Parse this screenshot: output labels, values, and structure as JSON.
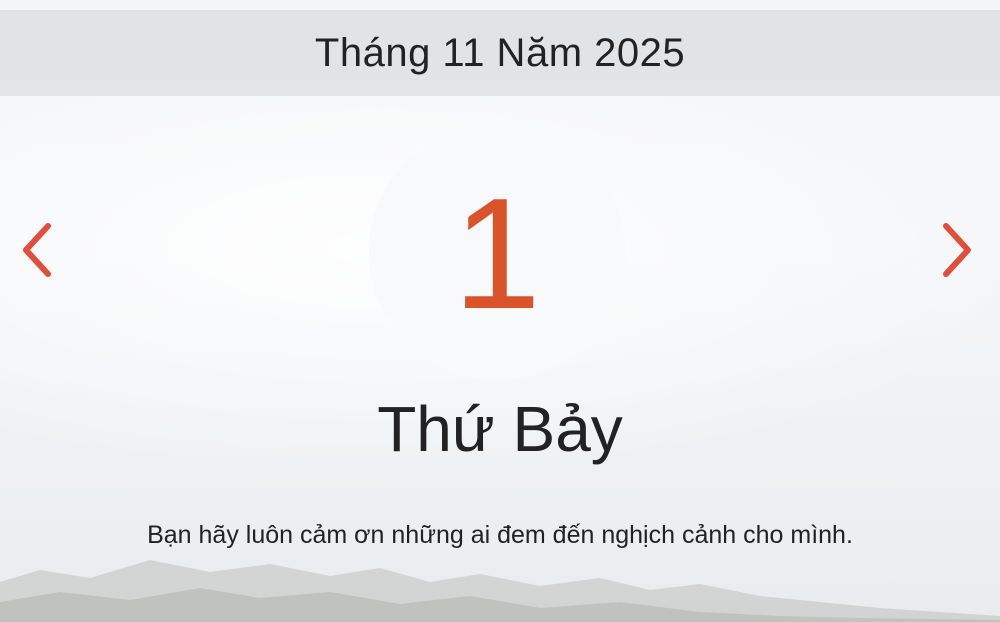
{
  "header": {
    "month_year": "Tháng 11 Năm 2025"
  },
  "navigation": {
    "prev_icon": "chevron-left-icon",
    "next_icon": "chevron-right-icon",
    "arrow_color": "#e04e3c"
  },
  "day": {
    "number": "1",
    "weekday": "Thứ Bảy",
    "number_color": "#d9532b"
  },
  "quote": {
    "text": "Bạn hãy luôn cảm ơn những ai đem đến nghịch cảnh cho mình."
  }
}
